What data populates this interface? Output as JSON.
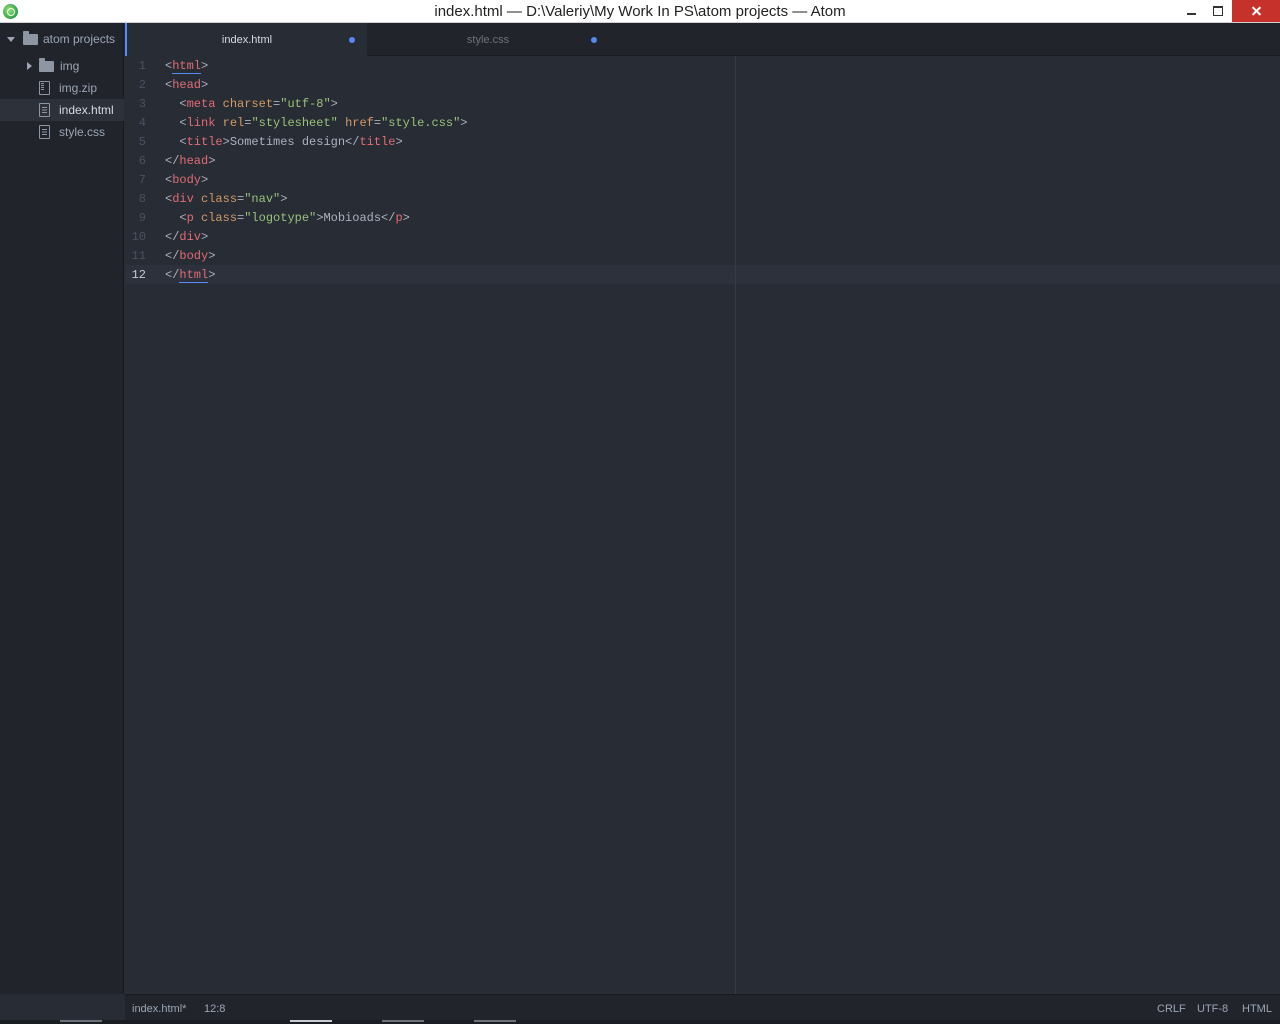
{
  "window": {
    "title": "index.html — D:\\Valeriy\\My Work In PS\\atom projects — Atom"
  },
  "sidebar": {
    "root": {
      "label": "atom projects",
      "expanded": true
    },
    "items": [
      {
        "label": "img",
        "kind": "folder",
        "expanded": false
      },
      {
        "label": "img.zip",
        "kind": "zip-file"
      },
      {
        "label": "index.html",
        "kind": "file",
        "selected": true
      },
      {
        "label": "style.css",
        "kind": "file"
      }
    ]
  },
  "tabs": [
    {
      "label": "index.html",
      "active": true,
      "modified": true
    },
    {
      "label": "style.css",
      "active": false,
      "modified": true
    }
  ],
  "editor": {
    "cursor_line": 12,
    "lines": [
      {
        "n": "1",
        "tokens": [
          {
            "t": "<",
            "c": "pn"
          },
          {
            "t": "html",
            "c": "tg bm"
          },
          {
            "t": ">",
            "c": "pn"
          }
        ]
      },
      {
        "n": "2",
        "tokens": [
          {
            "t": "<",
            "c": "pn"
          },
          {
            "t": "head",
            "c": "tg"
          },
          {
            "t": ">",
            "c": "pn"
          }
        ]
      },
      {
        "n": "3",
        "tokens": [
          {
            "t": "  <",
            "c": "pn"
          },
          {
            "t": "meta",
            "c": "tg"
          },
          {
            "t": " ",
            "c": "pn"
          },
          {
            "t": "charset",
            "c": "at"
          },
          {
            "t": "=",
            "c": "pn"
          },
          {
            "t": "\"utf-8\"",
            "c": "st"
          },
          {
            "t": ">",
            "c": "pn"
          }
        ]
      },
      {
        "n": "4",
        "tokens": [
          {
            "t": "  <",
            "c": "pn"
          },
          {
            "t": "link",
            "c": "tg"
          },
          {
            "t": " ",
            "c": "pn"
          },
          {
            "t": "rel",
            "c": "at"
          },
          {
            "t": "=",
            "c": "pn"
          },
          {
            "t": "\"stylesheet\"",
            "c": "st"
          },
          {
            "t": " ",
            "c": "pn"
          },
          {
            "t": "href",
            "c": "at"
          },
          {
            "t": "=",
            "c": "pn"
          },
          {
            "t": "\"style.css\"",
            "c": "st"
          },
          {
            "t": ">",
            "c": "pn"
          }
        ]
      },
      {
        "n": "5",
        "tokens": [
          {
            "t": "  <",
            "c": "pn"
          },
          {
            "t": "title",
            "c": "tg"
          },
          {
            "t": ">Sometimes design</",
            "c": "pn"
          },
          {
            "t": "title",
            "c": "tg"
          },
          {
            "t": ">",
            "c": "pn"
          }
        ]
      },
      {
        "n": "6",
        "tokens": [
          {
            "t": "</",
            "c": "pn"
          },
          {
            "t": "head",
            "c": "tg"
          },
          {
            "t": ">",
            "c": "pn"
          }
        ]
      },
      {
        "n": "7",
        "tokens": [
          {
            "t": "<",
            "c": "pn"
          },
          {
            "t": "body",
            "c": "tg"
          },
          {
            "t": ">",
            "c": "pn"
          }
        ]
      },
      {
        "n": "8",
        "tokens": [
          {
            "t": "<",
            "c": "pn"
          },
          {
            "t": "div",
            "c": "tg"
          },
          {
            "t": " ",
            "c": "pn"
          },
          {
            "t": "class",
            "c": "at"
          },
          {
            "t": "=",
            "c": "pn"
          },
          {
            "t": "\"nav\"",
            "c": "st"
          },
          {
            "t": ">",
            "c": "pn"
          }
        ]
      },
      {
        "n": "9",
        "tokens": [
          {
            "t": "  <",
            "c": "pn"
          },
          {
            "t": "p",
            "c": "tg"
          },
          {
            "t": " ",
            "c": "pn"
          },
          {
            "t": "class",
            "c": "at"
          },
          {
            "t": "=",
            "c": "pn"
          },
          {
            "t": "\"logotype\"",
            "c": "st"
          },
          {
            "t": ">Mobioads</",
            "c": "pn"
          },
          {
            "t": "p",
            "c": "tg"
          },
          {
            "t": ">",
            "c": "pn"
          }
        ]
      },
      {
        "n": "10",
        "tokens": [
          {
            "t": "</",
            "c": "pn"
          },
          {
            "t": "div",
            "c": "tg"
          },
          {
            "t": ">",
            "c": "pn"
          }
        ]
      },
      {
        "n": "11",
        "tokens": [
          {
            "t": "</",
            "c": "pn"
          },
          {
            "t": "body",
            "c": "tg"
          },
          {
            "t": ">",
            "c": "pn"
          }
        ]
      },
      {
        "n": "12",
        "tokens": [
          {
            "t": "</",
            "c": "pn"
          },
          {
            "t": "html",
            "c": "tg bm"
          },
          {
            "t": ">",
            "c": "pn"
          }
        ]
      }
    ]
  },
  "statusbar": {
    "file": "index.html*",
    "position": "12:8",
    "line_ending": "CRLF",
    "encoding": "UTF-8",
    "grammar": "HTML"
  },
  "colors": {
    "accent": "#528bff",
    "tag": "#e06c75",
    "attribute": "#d19a66",
    "string": "#98c379",
    "editor_bg": "#282c34",
    "sidebar_bg": "#21252b",
    "close_button": "#c7312b"
  }
}
